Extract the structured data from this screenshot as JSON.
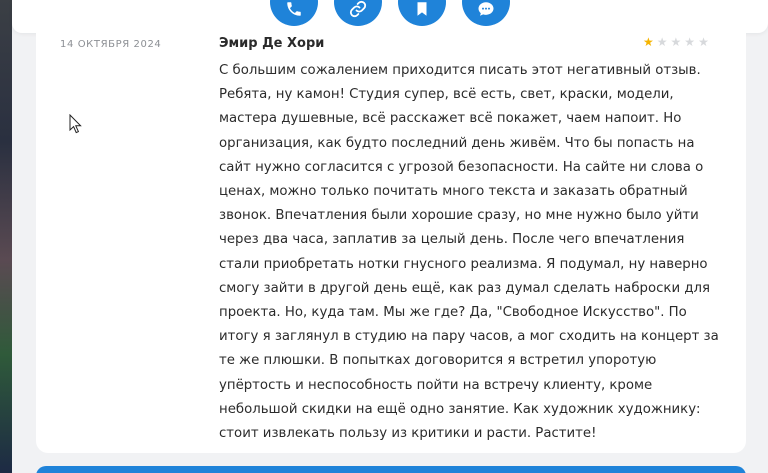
{
  "top_actions": [
    {
      "icon": "phone-icon"
    },
    {
      "icon": "link-icon"
    },
    {
      "icon": "bookmark-icon"
    },
    {
      "icon": "chat-icon"
    }
  ],
  "review": {
    "date": "14 октября 2024",
    "author": "Эмир Де Хори",
    "rating": 1,
    "rating_max": 5,
    "text": "С большим сожалением приходится писать этот негативный отзыв. Ребята, ну камон! Студия супер, всё есть, свет, краски, модели, мастера душевные, всё расскажет всё покажет, чаем напоит. Но организация, как будто последний день живём. Что бы попасть на сайт нужно согласится с угрозой безопасности. На сайте ни слова о ценах, можно только почитать много текста и заказать обратный звонок. Впечатления были хорошие сразу, но мне нужно было уйти через два часа, заплатив за целый день. После чего впечатления стали приобретать нотки гнусного реализма. Я подумал, ну наверно смогу зайти в другой день ещё, как раз думал сделать наброски для проекта. Но, куда там. Мы же где? Да, \"Свободное Искусство\". По итогу я заглянул в студию на пару часов, а мог сходить на концерт за те же плюшки. В попытках договорится я встретил упоротую упёртость и неспособность пойти на встречу клиенту, кроме небольшой скидки на ещё одно занятие. Как художник художнику: стоит извлекать пользу из критики и расти. Растите!"
  },
  "colors": {
    "accent": "#1f83d9",
    "star_on": "#f5b400",
    "star_off": "#d7d9dc"
  }
}
